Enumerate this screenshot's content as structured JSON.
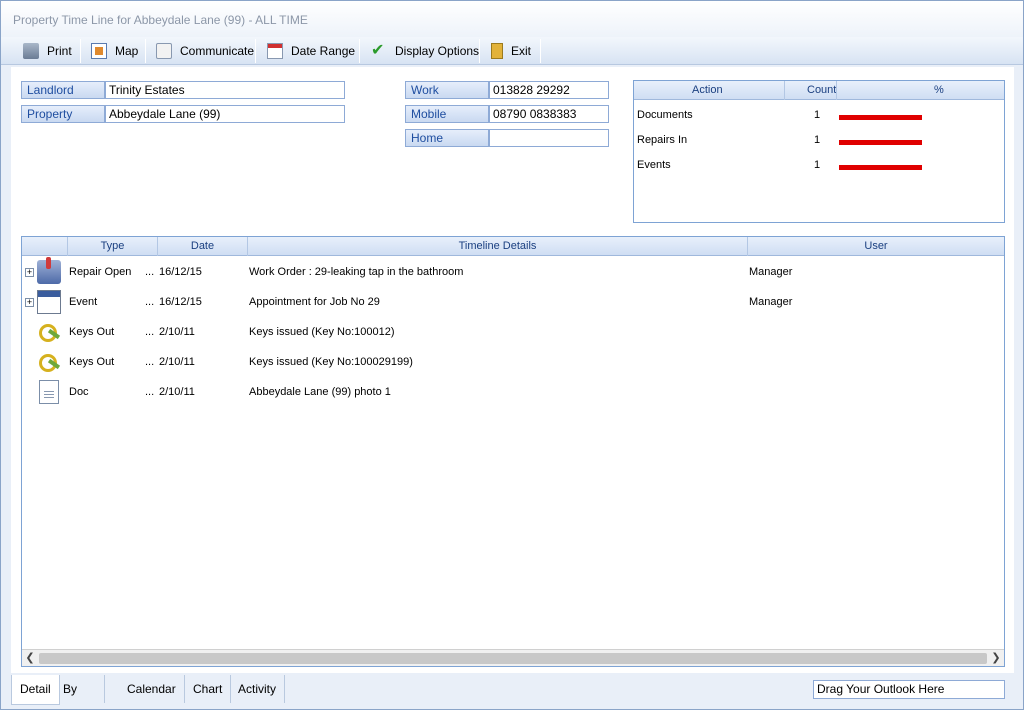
{
  "window": {
    "title": "Property Time Line for Abbeydale Lane (99) - ALL TIME"
  },
  "toolbar": {
    "print": "Print",
    "map": "Map",
    "communicate": "Communicate",
    "date_range": "Date Range",
    "display_options": "Display Options",
    "exit": "Exit"
  },
  "details": {
    "landlord_label": "Landlord",
    "landlord_value": "Trinity Estates",
    "property_label": "Property",
    "property_value": "Abbeydale Lane (99)",
    "work_label": "Work",
    "work_value": "013828 29292",
    "mobile_label": "Mobile",
    "mobile_value": "08790 0838383",
    "home_label": "Home",
    "home_value": ""
  },
  "stats": {
    "headers": {
      "action": "Action",
      "count": "Count",
      "percent": "%"
    },
    "rows": [
      {
        "action": "Documents",
        "count": "1",
        "percent": 100
      },
      {
        "action": "Repairs In",
        "count": "1",
        "percent": 100
      },
      {
        "action": "Events",
        "count": "1",
        "percent": 100
      }
    ],
    "bar_color": "#e00000"
  },
  "timeline": {
    "headers": {
      "type": "Type",
      "date": "Date",
      "details": "Timeline Details",
      "user": "User"
    },
    "rows": [
      {
        "icon": "repair-icon",
        "expandable": true,
        "type": "Repair Open",
        "ellipsis": "...",
        "date": "16/12/15",
        "details": "Work Order : 29-leaking tap in the bathroom",
        "user": "Manager"
      },
      {
        "icon": "event-icon",
        "expandable": true,
        "type": "Event",
        "ellipsis": "...",
        "date": "16/12/15",
        "details": "Appointment for Job No 29",
        "user": "Manager"
      },
      {
        "icon": "keys-icon",
        "expandable": false,
        "type": "Keys Out",
        "ellipsis": "...",
        "date": "2/10/11",
        "details": "Keys issued (Key No:100012)",
        "user": ""
      },
      {
        "icon": "keys-icon",
        "expandable": false,
        "type": "Keys Out",
        "ellipsis": "...",
        "date": "2/10/11",
        "details": "Keys issued (Key No:100029199)",
        "user": ""
      },
      {
        "icon": "doc-icon",
        "expandable": false,
        "type": "Doc",
        "ellipsis": "...",
        "date": "2/10/11",
        "details": "Abbeydale Lane (99) photo 1",
        "user": ""
      }
    ]
  },
  "tabs": [
    "Detail",
    "By Month",
    "Calendar",
    "Chart",
    "Activity"
  ],
  "active_tab": "Detail",
  "outlook_drop": "Drag Your Outlook Here"
}
